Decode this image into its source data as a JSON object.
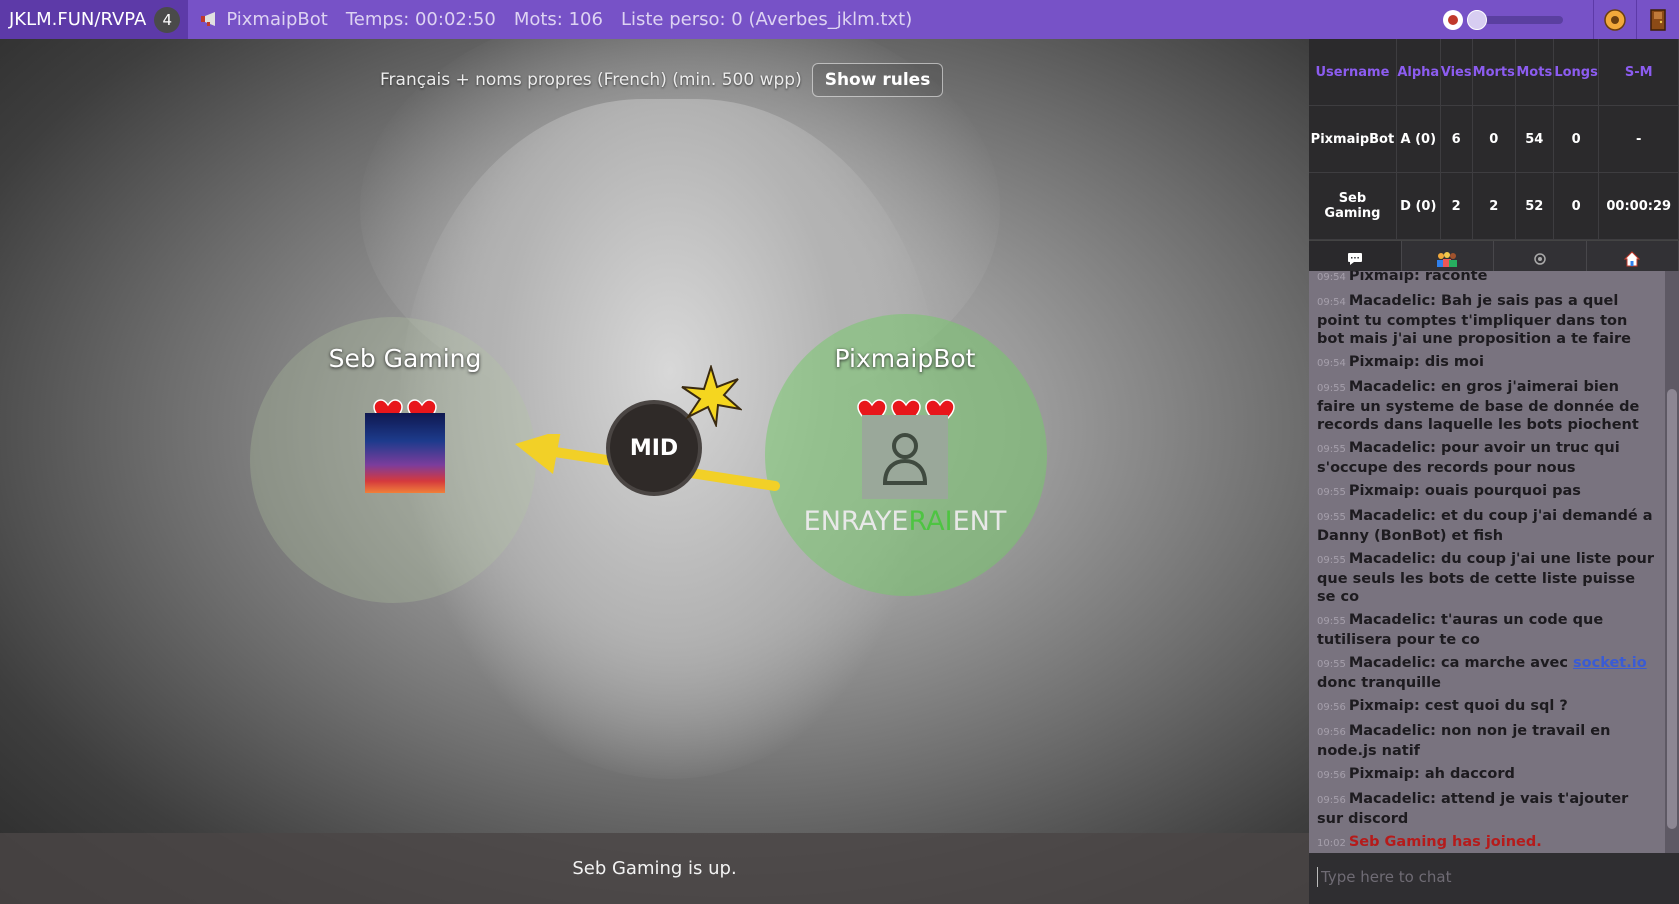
{
  "topbar": {
    "room_code": "JKLM.FUN/RVPA",
    "room_count": "4",
    "bot_name": "PixmaipBot",
    "time": "Temps: 00:02:50",
    "words": "Mots: 106",
    "list": "Liste perso: 0 (Averbes_jklm.txt)",
    "volume_level": 0,
    "icons": [
      "megaphone-icon",
      "mute-icon",
      "settings-icon",
      "exit-door-icon"
    ]
  },
  "game": {
    "rules_text": "Français + noms propres (French) (min. 500 wpp)",
    "show_rules_label": "Show rules",
    "bomb_syllable": "MID",
    "status_text": "Seb Gaming is up.",
    "players": [
      {
        "name": "Seb Gaming",
        "lives": 2
      },
      {
        "name": "PixmaipBot",
        "lives": 3,
        "word_pre": "ENRAYE",
        "word_hl": "RAI",
        "word_post": "ENT"
      }
    ]
  },
  "scoreboard": {
    "headers": [
      "Username",
      "Alpha",
      "Vies",
      "Morts",
      "Mots",
      "Longs",
      "S-M"
    ],
    "rows": [
      [
        "PixmaipBot",
        "A (0)",
        "6",
        "0",
        "54",
        "0",
        "-"
      ],
      [
        "Seb Gaming",
        "D (0)",
        "2",
        "2",
        "52",
        "0",
        "00:00:29"
      ]
    ]
  },
  "tabs": [
    "chat-icon",
    "players-icon",
    "settings-icon",
    "home-icon"
  ],
  "chat": {
    "messages": [
      {
        "time": "09:54",
        "text": "Pixmaip: raconte"
      },
      {
        "time": "09:54",
        "text": "Macadelic: Bah je sais pas a quel point tu comptes t'impliquer dans ton bot mais j'ai une  proposition a te faire"
      },
      {
        "time": "09:54",
        "text": "Pixmaip: dis moi"
      },
      {
        "time": "09:55",
        "text": "Macadelic: en gros j'aimerai bien faire un systeme de base de donnée de records dans laquelle les bots piochent"
      },
      {
        "time": "09:55",
        "text": "Macadelic: pour avoir un truc qui s'occupe des records pour nous"
      },
      {
        "time": "09:55",
        "text": "Pixmaip: ouais pourquoi pas"
      },
      {
        "time": "09:55",
        "text": "Macadelic: et du coup j'ai demandé a Danny (BonBot) et fish"
      },
      {
        "time": "09:55",
        "text": "Macadelic: du coup j'ai une liste pour que seuls les bots de cette liste puisse se co"
      },
      {
        "time": "09:55",
        "text": "Macadelic: t'auras un code que tutilisera pour te co"
      },
      {
        "time": "09:55",
        "text": "Macadelic: ca marche avec ",
        "link": "socket.io",
        "after": " donc tranquille"
      },
      {
        "time": "09:56",
        "text": "Pixmaip: cest quoi du sql ?"
      },
      {
        "time": "09:56",
        "text": "Macadelic: non non je travail en node.js natif"
      },
      {
        "time": "09:56",
        "text": "Pixmaip: ah daccord"
      },
      {
        "time": "09:56",
        "text": "Macadelic: attend je vais t'ajouter sur discord"
      },
      {
        "time": "10:02",
        "text": "Seb Gaming has joined.",
        "system": true
      }
    ],
    "input_placeholder": "Type here to chat"
  }
}
